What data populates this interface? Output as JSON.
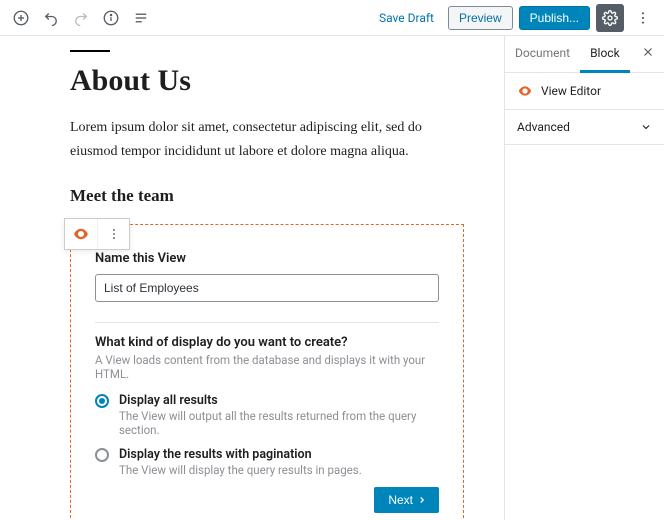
{
  "topbar": {
    "save_draft": "Save Draft",
    "preview": "Preview",
    "publish": "Publish..."
  },
  "page": {
    "title": "About Us",
    "paragraph": "Lorem ipsum dolor sit amet, consectetur adipiscing elit, sed do eiusmod tempor incididunt ut labore et dolore magna aliqua.",
    "heading": "Meet the team"
  },
  "view": {
    "name_label": "Name this View",
    "name_value": "List of Employees",
    "display_question": "What kind of display do you want to create?",
    "display_hint": "A View loads content from the database and displays it with your HTML.",
    "options": [
      {
        "label": "Display all results",
        "hint": "The View will output all the results returned from the query section.",
        "checked": true
      },
      {
        "label": "Display the results with pagination",
        "hint": "The View will display the query results in pages.",
        "checked": false
      }
    ],
    "next_label": "Next"
  },
  "sidebar": {
    "tabs": {
      "document": "Document",
      "block": "Block"
    },
    "block_name": "View Editor",
    "advanced": "Advanced"
  }
}
